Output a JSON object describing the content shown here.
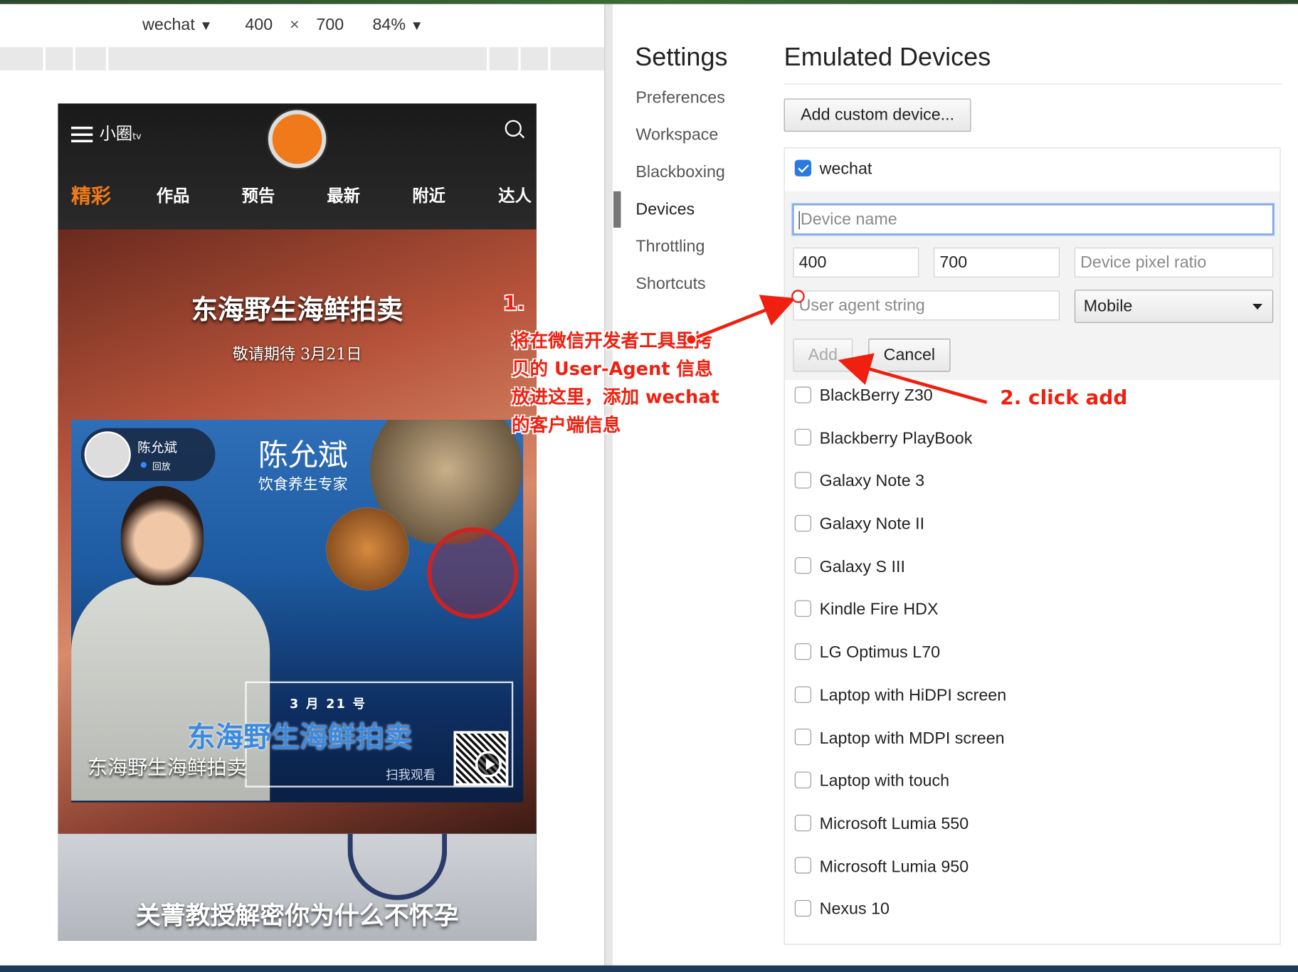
{
  "device_toolbar": {
    "device": "wechat",
    "width": "400",
    "times": "×",
    "height": "700",
    "zoom": "84%"
  },
  "phone": {
    "logo": "小圈",
    "logo_suffix": "tv",
    "nav": [
      "精彩",
      "作品",
      "预告",
      "最新",
      "附近",
      "达人"
    ],
    "active_nav": "精彩",
    "hero_title": "东海野生海鲜拍卖",
    "hero_subtitle": "敬请期待 3月21日",
    "card": {
      "host_name": "陈允斌",
      "host_status": "回放",
      "name": "陈允斌",
      "role": "饮食养生专家",
      "date": "3 月 21 号",
      "big_title": "东海野生海鲜拍卖",
      "scan": "扫我观看",
      "caption": "东海野生海鲜拍卖"
    },
    "bottom_title": "关菁教授解密你为什么不怀孕"
  },
  "annotations": {
    "step1": "1.",
    "step1_body": "将在微信开发者工具里拷贝的 User-Agent 信息放进这里，添加 wechat 的客户端信息",
    "step2": "2. click add"
  },
  "settings": {
    "title": "Settings",
    "nav": [
      "Preferences",
      "Workspace",
      "Blackboxing",
      "Devices",
      "Throttling",
      "Shortcuts"
    ],
    "active": "Devices",
    "section_title": "Emulated Devices",
    "add_custom": "Add custom device...",
    "current_device": "wechat",
    "form": {
      "name_placeholder": "Device name",
      "width": "400",
      "height": "700",
      "dpr_placeholder": "Device pixel ratio",
      "ua_placeholder": "User agent string",
      "type": "Mobile",
      "add": "Add",
      "cancel": "Cancel"
    },
    "devices": [
      "BlackBerry Z30",
      "Blackberry PlayBook",
      "Galaxy Note 3",
      "Galaxy Note II",
      "Galaxy S III",
      "Kindle Fire HDX",
      "LG Optimus L70",
      "Laptop with HiDPI screen",
      "Laptop with MDPI screen",
      "Laptop with touch",
      "Microsoft Lumia 550",
      "Microsoft Lumia 950",
      "Nexus 10"
    ]
  },
  "colors": {
    "accent_orange": "#f07a1a",
    "annotation_red": "#f02010",
    "checkbox_blue": "#2a7ae2"
  }
}
